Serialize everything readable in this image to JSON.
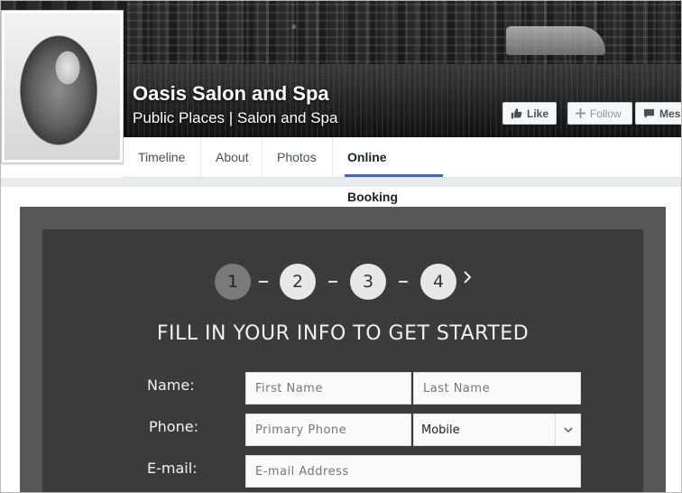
{
  "page": {
    "name": "Oasis Salon and Spa",
    "category": "Public Places | Salon and Spa"
  },
  "actions": {
    "like": "Like",
    "follow": "Follow",
    "message": "Mess"
  },
  "tabs": [
    {
      "label": "Timeline"
    },
    {
      "label": "About"
    },
    {
      "label": "Photos"
    },
    {
      "label": "Online Booking",
      "active": true
    }
  ],
  "booking": {
    "steps": [
      "1",
      "2",
      "3",
      "4"
    ],
    "active_step": "1",
    "heading": "FILL IN YOUR INFO TO GET STARTED",
    "name_label": "Name:",
    "phone_label": "Phone:",
    "email_label": "E-mail:",
    "first_name_placeholder": "First Name",
    "last_name_placeholder": "Last Name",
    "phone_placeholder": "Primary Phone",
    "phone_type": "Mobile",
    "email_placeholder": "E-mail Address"
  },
  "icons": {
    "like": "thumbs-up-icon",
    "follow": "plus-icon",
    "message": "message-icon",
    "next": "chevron-right-icon",
    "select": "chevron-down-icon"
  },
  "colors": {
    "tab_underline": "#4267b2",
    "panel_outer": "#575757",
    "panel_inner": "#3b3b3b"
  }
}
